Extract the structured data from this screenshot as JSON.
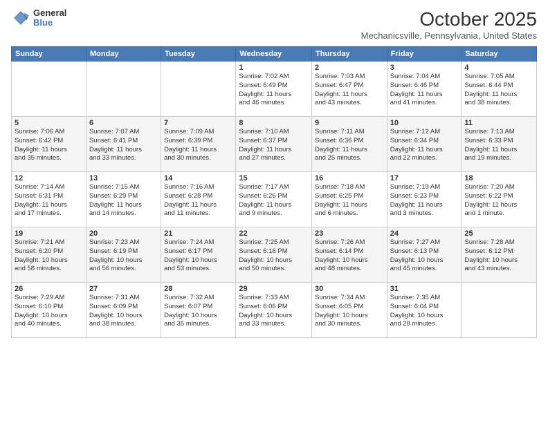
{
  "header": {
    "logo_general": "General",
    "logo_blue": "Blue",
    "month_title": "October 2025",
    "location": "Mechanicsville, Pennsylvania, United States"
  },
  "days_of_week": [
    "Sunday",
    "Monday",
    "Tuesday",
    "Wednesday",
    "Thursday",
    "Friday",
    "Saturday"
  ],
  "weeks": [
    [
      {
        "num": "",
        "info": ""
      },
      {
        "num": "",
        "info": ""
      },
      {
        "num": "",
        "info": ""
      },
      {
        "num": "1",
        "info": "Sunrise: 7:02 AM\nSunset: 6:49 PM\nDaylight: 11 hours\nand 46 minutes."
      },
      {
        "num": "2",
        "info": "Sunrise: 7:03 AM\nSunset: 6:47 PM\nDaylight: 11 hours\nand 43 minutes."
      },
      {
        "num": "3",
        "info": "Sunrise: 7:04 AM\nSunset: 6:46 PM\nDaylight: 11 hours\nand 41 minutes."
      },
      {
        "num": "4",
        "info": "Sunrise: 7:05 AM\nSunset: 6:44 PM\nDaylight: 11 hours\nand 38 minutes."
      }
    ],
    [
      {
        "num": "5",
        "info": "Sunrise: 7:06 AM\nSunset: 6:42 PM\nDaylight: 11 hours\nand 35 minutes."
      },
      {
        "num": "6",
        "info": "Sunrise: 7:07 AM\nSunset: 6:41 PM\nDaylight: 11 hours\nand 33 minutes."
      },
      {
        "num": "7",
        "info": "Sunrise: 7:09 AM\nSunset: 6:39 PM\nDaylight: 11 hours\nand 30 minutes."
      },
      {
        "num": "8",
        "info": "Sunrise: 7:10 AM\nSunset: 6:37 PM\nDaylight: 11 hours\nand 27 minutes."
      },
      {
        "num": "9",
        "info": "Sunrise: 7:11 AM\nSunset: 6:36 PM\nDaylight: 11 hours\nand 25 minutes."
      },
      {
        "num": "10",
        "info": "Sunrise: 7:12 AM\nSunset: 6:34 PM\nDaylight: 11 hours\nand 22 minutes."
      },
      {
        "num": "11",
        "info": "Sunrise: 7:13 AM\nSunset: 6:33 PM\nDaylight: 11 hours\nand 19 minutes."
      }
    ],
    [
      {
        "num": "12",
        "info": "Sunrise: 7:14 AM\nSunset: 6:31 PM\nDaylight: 11 hours\nand 17 minutes."
      },
      {
        "num": "13",
        "info": "Sunrise: 7:15 AM\nSunset: 6:29 PM\nDaylight: 11 hours\nand 14 minutes."
      },
      {
        "num": "14",
        "info": "Sunrise: 7:16 AM\nSunset: 6:28 PM\nDaylight: 11 hours\nand 11 minutes."
      },
      {
        "num": "15",
        "info": "Sunrise: 7:17 AM\nSunset: 6:26 PM\nDaylight: 11 hours\nand 9 minutes."
      },
      {
        "num": "16",
        "info": "Sunrise: 7:18 AM\nSunset: 6:25 PM\nDaylight: 11 hours\nand 6 minutes."
      },
      {
        "num": "17",
        "info": "Sunrise: 7:19 AM\nSunset: 6:23 PM\nDaylight: 11 hours\nand 3 minutes."
      },
      {
        "num": "18",
        "info": "Sunrise: 7:20 AM\nSunset: 6:22 PM\nDaylight: 11 hours\nand 1 minute."
      }
    ],
    [
      {
        "num": "19",
        "info": "Sunrise: 7:21 AM\nSunset: 6:20 PM\nDaylight: 10 hours\nand 58 minutes."
      },
      {
        "num": "20",
        "info": "Sunrise: 7:23 AM\nSunset: 6:19 PM\nDaylight: 10 hours\nand 56 minutes."
      },
      {
        "num": "21",
        "info": "Sunrise: 7:24 AM\nSunset: 6:17 PM\nDaylight: 10 hours\nand 53 minutes."
      },
      {
        "num": "22",
        "info": "Sunrise: 7:25 AM\nSunset: 6:16 PM\nDaylight: 10 hours\nand 50 minutes."
      },
      {
        "num": "23",
        "info": "Sunrise: 7:26 AM\nSunset: 6:14 PM\nDaylight: 10 hours\nand 48 minutes."
      },
      {
        "num": "24",
        "info": "Sunrise: 7:27 AM\nSunset: 6:13 PM\nDaylight: 10 hours\nand 45 minutes."
      },
      {
        "num": "25",
        "info": "Sunrise: 7:28 AM\nSunset: 6:12 PM\nDaylight: 10 hours\nand 43 minutes."
      }
    ],
    [
      {
        "num": "26",
        "info": "Sunrise: 7:29 AM\nSunset: 6:10 PM\nDaylight: 10 hours\nand 40 minutes."
      },
      {
        "num": "27",
        "info": "Sunrise: 7:31 AM\nSunset: 6:09 PM\nDaylight: 10 hours\nand 38 minutes."
      },
      {
        "num": "28",
        "info": "Sunrise: 7:32 AM\nSunset: 6:07 PM\nDaylight: 10 hours\nand 35 minutes."
      },
      {
        "num": "29",
        "info": "Sunrise: 7:33 AM\nSunset: 6:06 PM\nDaylight: 10 hours\nand 33 minutes."
      },
      {
        "num": "30",
        "info": "Sunrise: 7:34 AM\nSunset: 6:05 PM\nDaylight: 10 hours\nand 30 minutes."
      },
      {
        "num": "31",
        "info": "Sunrise: 7:35 AM\nSunset: 6:04 PM\nDaylight: 10 hours\nand 28 minutes."
      },
      {
        "num": "",
        "info": ""
      }
    ]
  ]
}
